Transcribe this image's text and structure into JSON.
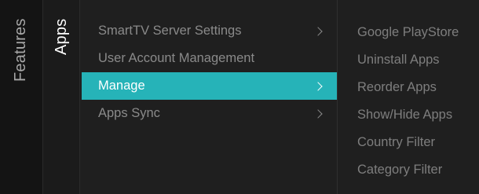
{
  "breadcrumb": {
    "level1": "Features",
    "level2": "Apps"
  },
  "menu": {
    "items": [
      {
        "label": "SmartTV Server Settings",
        "has_arrow": true,
        "selected": false
      },
      {
        "label": "User Account Management",
        "has_arrow": false,
        "selected": false
      },
      {
        "label": "Manage",
        "has_arrow": true,
        "selected": true
      },
      {
        "label": "Apps Sync",
        "has_arrow": true,
        "selected": false
      }
    ]
  },
  "submenu": {
    "items": [
      "Google PlayStore",
      "Uninstall Apps",
      "Reorder Apps",
      "Show/Hide Apps",
      "Country Filter",
      "Category Filter"
    ]
  },
  "colors": {
    "selection": "#26b3b8",
    "background": "#1f1f1f"
  }
}
